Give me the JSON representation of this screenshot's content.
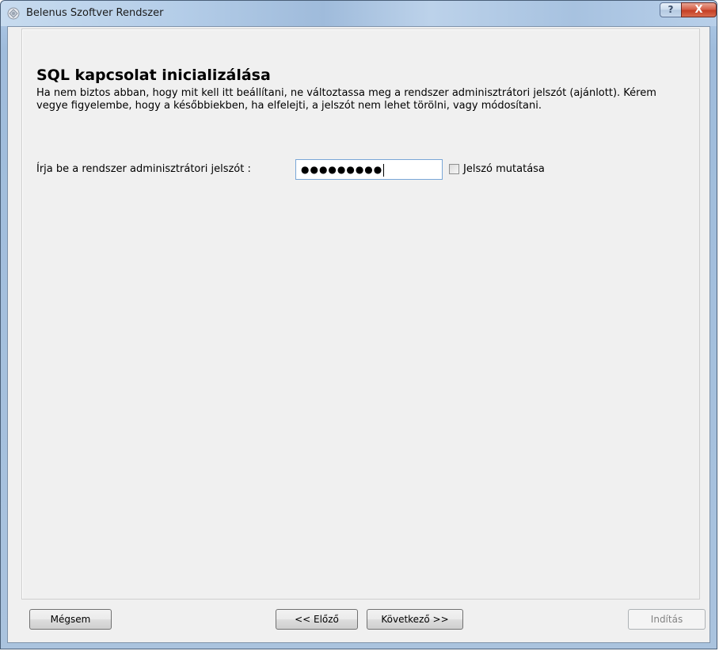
{
  "window": {
    "title": "Belenus Szoftver Rendszer",
    "help_label": "?",
    "close_label": "X"
  },
  "page": {
    "heading": "SQL kapcsolat inicializálása",
    "description": "Ha nem biztos abban, hogy mit kell itt beállítani, ne változtassa meg a rendszer adminisztrátori jelszót (ajánlott). Kérem vegye figyelembe, hogy a későbbiekben, ha elfelejti, a jelszót nem lehet törölni, vagy módosítani.",
    "password_label": "Írja be a rendszer adminisztrátori jelszót :",
    "password_masked": "●●●●●●●●●",
    "show_password_label": "Jelszó mutatása",
    "show_password_checked": false
  },
  "buttons": {
    "cancel": "Mégsem",
    "previous": "<< Előző",
    "next": "Következő >>",
    "start": "Indítás"
  },
  "colors": {
    "title_bar": "#b4cde8",
    "close_button": "#c43f26",
    "client_background": "#f0f0f0"
  }
}
